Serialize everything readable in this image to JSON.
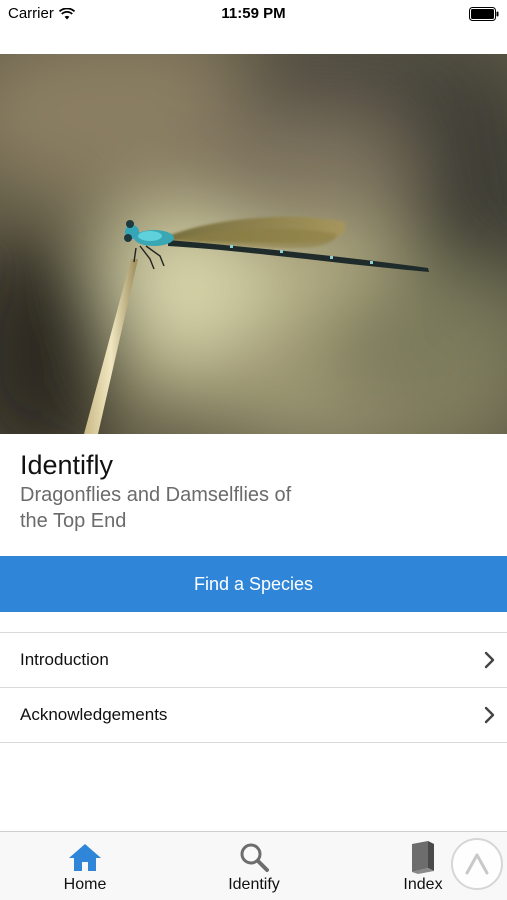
{
  "status_bar": {
    "carrier": "Carrier",
    "time": "11:59 PM"
  },
  "hero": {
    "icon": "damselfly-photo"
  },
  "header": {
    "title": "Identifly",
    "subtitle": "Dragonflies and Damselflies of the Top End"
  },
  "actions": {
    "find_label": "Find a Species",
    "accent_color": "#2f86d9"
  },
  "menu": {
    "items": [
      {
        "label": "Introduction"
      },
      {
        "label": "Acknowledgements"
      }
    ]
  },
  "tabs": [
    {
      "label": "Home",
      "icon": "home-icon",
      "active": true
    },
    {
      "label": "Identify",
      "icon": "search-icon",
      "active": false
    },
    {
      "label": "Index",
      "icon": "book-icon",
      "active": false
    }
  ],
  "colors": {
    "active_tab": "#2f86d9",
    "inactive_tab": "#6d6d6d"
  }
}
